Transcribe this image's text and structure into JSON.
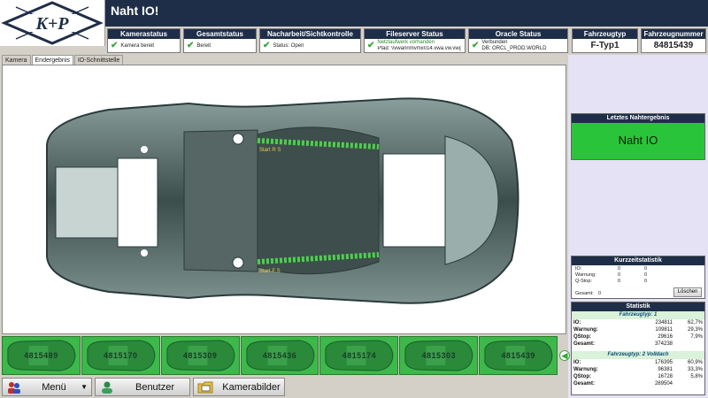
{
  "logo": {
    "text": "K+P"
  },
  "title": "Naht IO!",
  "status": {
    "kamera": {
      "header": "Kamerastatus",
      "text": "Kamera bereit"
    },
    "gesamt": {
      "header": "Gesamtstatus",
      "text": "Bereit"
    },
    "nacharbeit": {
      "header": "Nacharbeit/Sichtkontrolle",
      "text": "Status: Open"
    },
    "fileserver": {
      "header": "Fileserver Status",
      "line1": "Netzlaufwerk vorhanden",
      "line2": "Pfad: \\\\vwannmvmx014.vwa.vw.vwg\\dachnah..."
    },
    "oracle": {
      "header": "Oracle Status",
      "line1": "Verbunden",
      "line2": "DB:  ORCL_PROD.WORLD"
    },
    "fahrzeugtyp": {
      "header": "Fahrzeugtyp",
      "value": "F-Typ1"
    },
    "fahrzeugnummer": {
      "header": "Fahrzeugnummer",
      "value": "84815439"
    }
  },
  "tabs": [
    "Kamera",
    "Endergebnis",
    "IO-Schnittstelle"
  ],
  "viewer": {
    "start_top": "Start R S",
    "start_bottom": "Start F S"
  },
  "letztes": {
    "header": "Letztes Nahtergebnis",
    "value": "Naht IO"
  },
  "kurz": {
    "header": "Kurzzeitstatistik",
    "rows": [
      {
        "label": "IO:",
        "a": "0",
        "b": "0"
      },
      {
        "label": "Warnung:",
        "a": "0",
        "b": "0"
      },
      {
        "label": "Q-Stop:",
        "a": "0",
        "b": "0"
      }
    ],
    "gesamt_label": "Gesamt:",
    "gesamt_value": "0",
    "reset_label": "Löschen"
  },
  "statistik": {
    "header": "Statistik",
    "groups": [
      {
        "title": "Fahrzeugtyp:  1",
        "rows": [
          {
            "l": "IO:",
            "n": "234811",
            "p": "62,7%"
          },
          {
            "l": "Warnung:",
            "n": "109811",
            "p": "29,3%"
          },
          {
            "l": "QStop:",
            "n": "29616",
            "p": "7,9%"
          }
        ],
        "gesamt": "374238"
      },
      {
        "title": "Fahrzeugtyp:  2 Volldach",
        "rows": [
          {
            "l": "IO:",
            "n": "176395",
            "p": "60,9%"
          },
          {
            "l": "Warnung:",
            "n": "96381",
            "p": "33,3%"
          },
          {
            "l": "QStop:",
            "n": "16728",
            "p": "5,8%"
          }
        ],
        "gesamt": "289504"
      }
    ],
    "gesamt_label": "Gesamt:"
  },
  "thumbs": [
    "4815489",
    "4815170",
    "4815309",
    "4815436",
    "4815174",
    "4815303",
    "4815439"
  ],
  "buttons": {
    "menu": "Menü",
    "benutzer": "Benutzer",
    "kamerabilder": "Kamerabilder"
  },
  "colors": {
    "header_bg": "#1f2e48",
    "ok_green": "#2ac43a",
    "panel_bg": "#e4e2f4"
  }
}
